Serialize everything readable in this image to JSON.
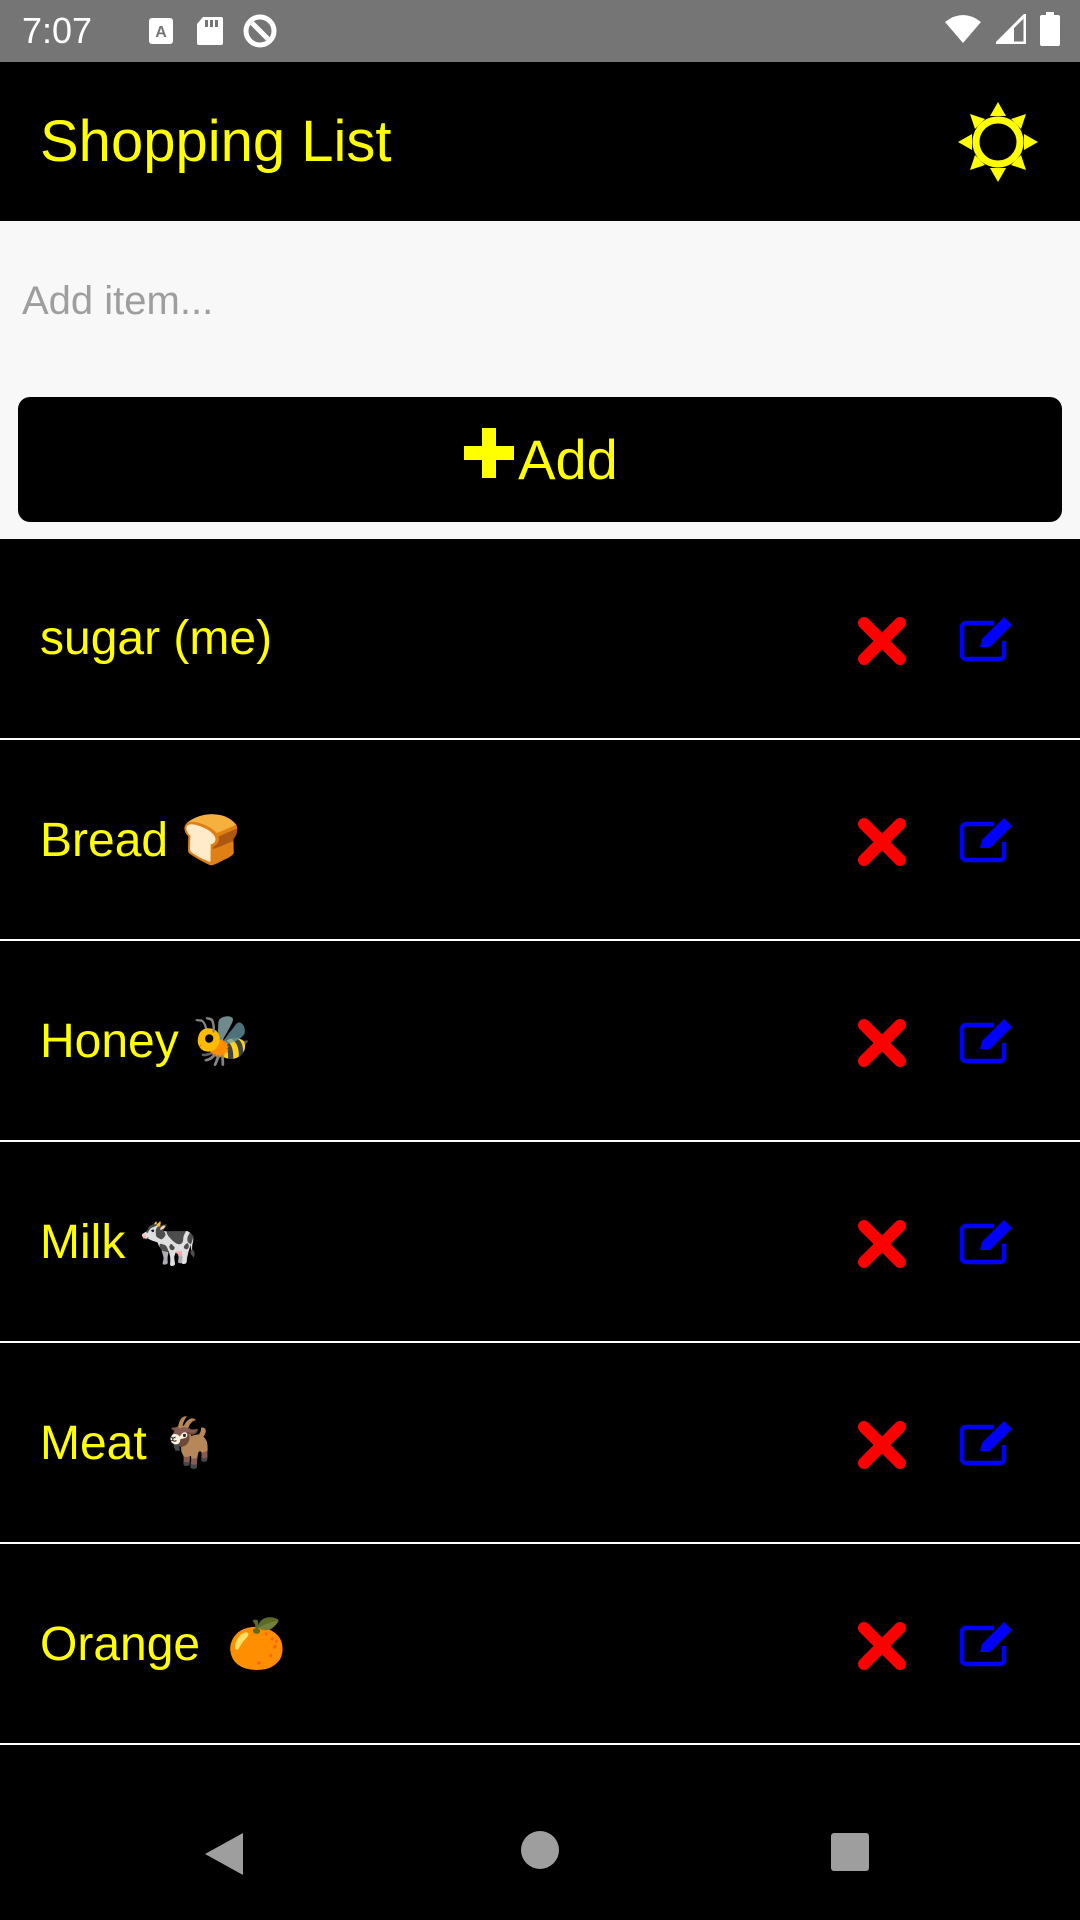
{
  "status_bar": {
    "time": "7:07",
    "left_icons": [
      "a-badge-icon",
      "sd-card-icon",
      "sync-circle-icon"
    ],
    "right_icons": [
      "wifi-icon",
      "signal-icon",
      "battery-icon"
    ]
  },
  "app_bar": {
    "title": "Shopping List",
    "theme_icon": "sun-icon"
  },
  "input": {
    "placeholder": "Add item...",
    "value": ""
  },
  "add_button": {
    "label": "Add",
    "icon": "plus-icon"
  },
  "items": [
    {
      "label": "sugar (me)"
    },
    {
      "label": "Bread 🍞"
    },
    {
      "label": "Honey 🐝"
    },
    {
      "label": "Milk 🐄"
    },
    {
      "label": "Meat 🐐"
    },
    {
      "label": "Orange  🍊"
    }
  ],
  "colors": {
    "accent": "#ffff00",
    "background": "#000000",
    "delete": "#ff0000",
    "edit": "#0000ff",
    "status_bar": "#757575",
    "input_panel": "#f8f8f8"
  },
  "nav_bar": {
    "icons": [
      "back-icon",
      "home-icon",
      "recent-apps-icon"
    ]
  }
}
